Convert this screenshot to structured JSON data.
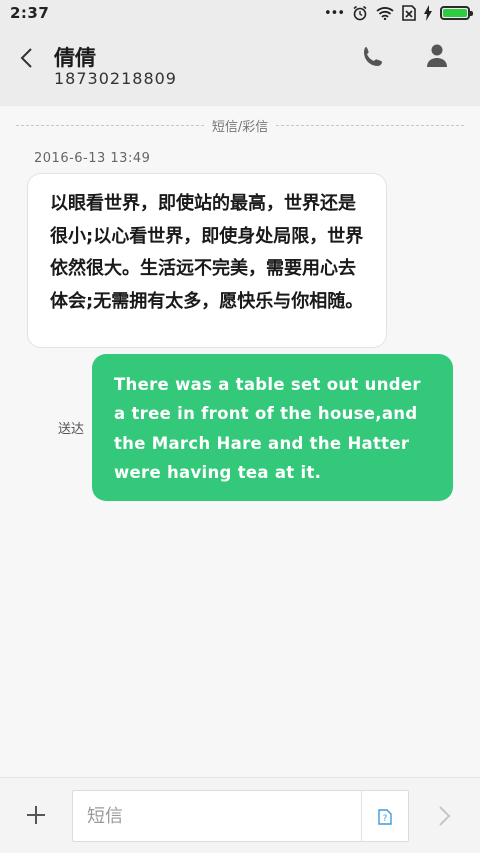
{
  "status_bar": {
    "time": "2:37",
    "dots": "•••",
    "battery_level": 1.0,
    "battery_color": "#2ecc40"
  },
  "header": {
    "contact_name": "倩倩",
    "contact_number": "18730218809",
    "icons": [
      "back-arrow-icon",
      "phone-icon",
      "person-icon"
    ]
  },
  "conversation": {
    "divider_label": "短信/彩信",
    "timestamp": "2016-6-13 13:49",
    "incoming_message": "以眼看世界，即使站的最高，世界还是很小;以心看世界，即使身处局限，世界依然很大。生活远不完美，需要用心去体会;无需拥有太多，愿快乐与你相随。",
    "sent_status": "送达",
    "outgoing_message": "There was a table set out under a tree in front of the house,and the March Hare and the Hatter were having tea at it.",
    "outgoing_bubble_color": "#34c97a"
  },
  "input_bar": {
    "placeholder": "短信",
    "value": "",
    "sim_label": "?",
    "icons": [
      "add-icon",
      "sim-card-icon",
      "send-arrow-icon"
    ]
  }
}
